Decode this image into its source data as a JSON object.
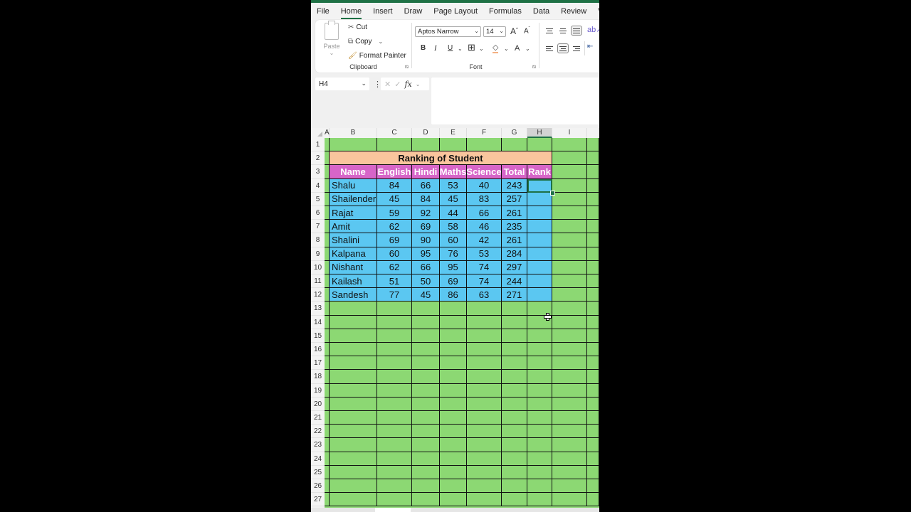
{
  "ribbon_tabs": [
    {
      "label": "File",
      "active": false
    },
    {
      "label": "Home",
      "active": true
    },
    {
      "label": "Insert",
      "active": false
    },
    {
      "label": "Draw",
      "active": false
    },
    {
      "label": "Page Layout",
      "active": false
    },
    {
      "label": "Formulas",
      "active": false
    },
    {
      "label": "Data",
      "active": false
    },
    {
      "label": "Review",
      "active": false
    },
    {
      "label": "View",
      "active": false
    }
  ],
  "clipboard": {
    "paste_label": "Paste",
    "cut_label": "Cut",
    "copy_label": "Copy",
    "format_painter_label": "Format Painter",
    "group_label": "Clipboard"
  },
  "font": {
    "font_name": "Aptos Narrow",
    "font_size": "14",
    "bold_label": "B",
    "italic_label": "I",
    "underline_label": "U",
    "font_color_label": "A",
    "grow_label": "A",
    "shrink_label": "A",
    "group_label": "Font"
  },
  "formula_bar": {
    "name_box": "H4",
    "fx_label": "fx",
    "formula": ""
  },
  "columns": [
    "A",
    "B",
    "C",
    "D",
    "E",
    "F",
    "G",
    "H",
    "I"
  ],
  "selected_column": "H",
  "selected_cell": "H4",
  "rows": [
    "1",
    "2",
    "3",
    "4",
    "5",
    "6",
    "7",
    "8",
    "9",
    "10",
    "11",
    "12",
    "13",
    "14",
    "15",
    "16",
    "17",
    "18",
    "19",
    "20",
    "21",
    "22",
    "23",
    "24",
    "25",
    "26",
    "27"
  ],
  "sheet": {
    "title": "Ranking of Student",
    "headers": [
      "Name",
      "English",
      "Hindi",
      "Maths",
      "Science",
      "Total",
      "Rank"
    ],
    "students": [
      {
        "name": "Shalu",
        "english": "84",
        "hindi": "66",
        "maths": "53",
        "science": "40",
        "total": "243",
        "rank": ""
      },
      {
        "name": "Shailender",
        "english": "45",
        "hindi": "84",
        "maths": "45",
        "science": "83",
        "total": "257",
        "rank": ""
      },
      {
        "name": "Rajat",
        "english": "59",
        "hindi": "92",
        "maths": "44",
        "science": "66",
        "total": "261",
        "rank": ""
      },
      {
        "name": "Amit",
        "english": "62",
        "hindi": "69",
        "maths": "58",
        "science": "46",
        "total": "235",
        "rank": ""
      },
      {
        "name": "Shalini",
        "english": "69",
        "hindi": "90",
        "maths": "60",
        "science": "42",
        "total": "261",
        "rank": ""
      },
      {
        "name": "Kalpana",
        "english": "60",
        "hindi": "95",
        "maths": "76",
        "science": "53",
        "total": "284",
        "rank": ""
      },
      {
        "name": "Nishant",
        "english": "62",
        "hindi": "66",
        "maths": "95",
        "science": "74",
        "total": "297",
        "rank": ""
      },
      {
        "name": "Kailash",
        "english": "51",
        "hindi": "50",
        "maths": "69",
        "science": "74",
        "total": "244",
        "rank": ""
      },
      {
        "name": "Sandesh",
        "english": "77",
        "hindi": "45",
        "maths": "86",
        "science": "63",
        "total": "271",
        "rank": ""
      }
    ]
  },
  "colors": {
    "sheet_fill": "#8cd873",
    "title_fill": "#f9c59d",
    "header_fill": "#d765c8",
    "data_fill": "#5bc7f1",
    "accent": "#1e7145"
  }
}
